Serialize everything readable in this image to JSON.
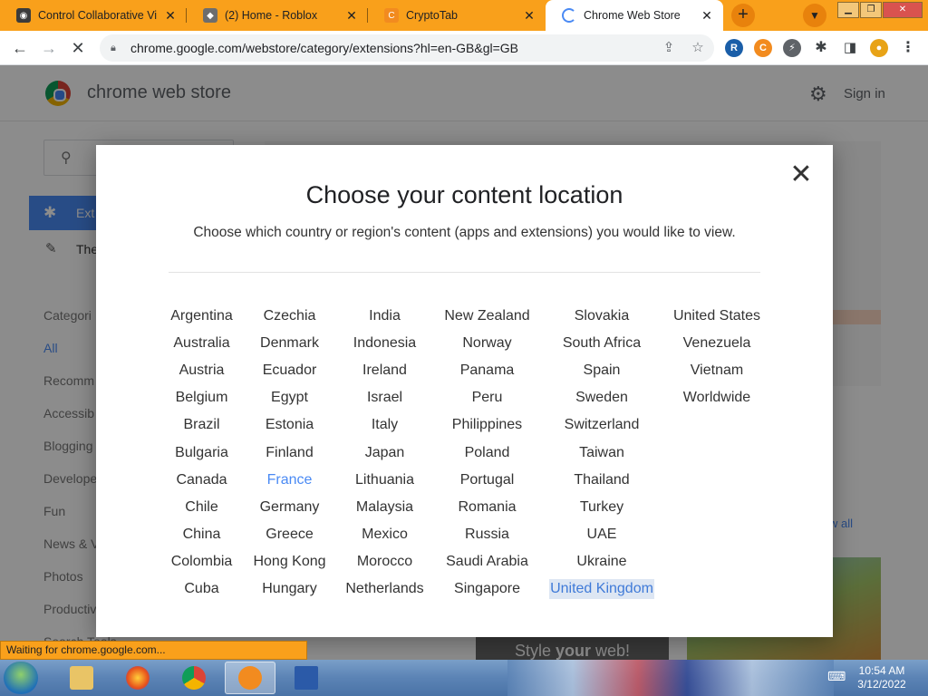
{
  "tabs": [
    {
      "title": "Control Collaborative Vir",
      "close": "✕"
    },
    {
      "title": "(2) Home - Roblox",
      "close": "✕"
    },
    {
      "title": "CryptoTab",
      "close": "✕"
    },
    {
      "title": "Chrome Web Store",
      "close": "✕"
    }
  ],
  "omnibox": {
    "url": "chrome.google.com/webstore/category/extensions?hl=en-GB&gl=GB"
  },
  "store": {
    "title": "chrome web store",
    "sign_in": "Sign in",
    "nav_extensions": "Ext",
    "nav_themes": "The",
    "categories_heading": "Categori",
    "categories": [
      "All",
      "Recomm",
      "Accessib",
      "Blogging",
      "Develope",
      "Fun",
      "News & V",
      "Photos",
      "Productiv",
      "Search Tools"
    ],
    "view_all": "w all",
    "card_text_pre": "Style ",
    "card_text_bold": "your",
    "card_text_post": " web!"
  },
  "dialog": {
    "title": "Choose your content location",
    "subtitle": "Choose which country or region's content (apps and extensions) you would like to view.",
    "selected_country": "France",
    "hovered_country": "United Kingdom",
    "columns": [
      [
        "Argentina",
        "Australia",
        "Austria",
        "Belgium",
        "Brazil",
        "Bulgaria",
        "Canada",
        "Chile",
        "China",
        "Colombia",
        "Cuba"
      ],
      [
        "Czechia",
        "Denmark",
        "Ecuador",
        "Egypt",
        "Estonia",
        "Finland",
        "France",
        "Germany",
        "Greece",
        "Hong Kong",
        "Hungary"
      ],
      [
        "India",
        "Indonesia",
        "Ireland",
        "Israel",
        "Italy",
        "Japan",
        "Lithuania",
        "Malaysia",
        "Mexico",
        "Morocco",
        "Netherlands"
      ],
      [
        "New Zealand",
        "Norway",
        "Panama",
        "Peru",
        "Philippines",
        "Poland",
        "Portugal",
        "Romania",
        "Russia",
        "Saudi Arabia",
        "Singapore"
      ],
      [
        "Slovakia",
        "South Africa",
        "Spain",
        "Sweden",
        "Switzerland",
        "Taiwan",
        "Thailand",
        "Turkey",
        "UAE",
        "Ukraine",
        "United Kingdom"
      ],
      [
        "United States",
        "Venezuela",
        "Vietnam",
        "Worldwide"
      ]
    ]
  },
  "status_text": "Waiting for chrome.google.com...",
  "clock": {
    "time": "10:54 AM",
    "date": "3/12/2022"
  },
  "icons": {
    "back": "back-arrow-icon",
    "forward": "forward-arrow-icon",
    "stop": "stop-icon",
    "lock": "lock-icon",
    "share": "share-icon",
    "star": "star-icon",
    "gear": "gear-icon",
    "close": "close-icon"
  },
  "colors": {
    "tab_strip": "#f9a01b",
    "accent_blue": "#4a8af4",
    "hover_bg": "#dde6f3"
  }
}
